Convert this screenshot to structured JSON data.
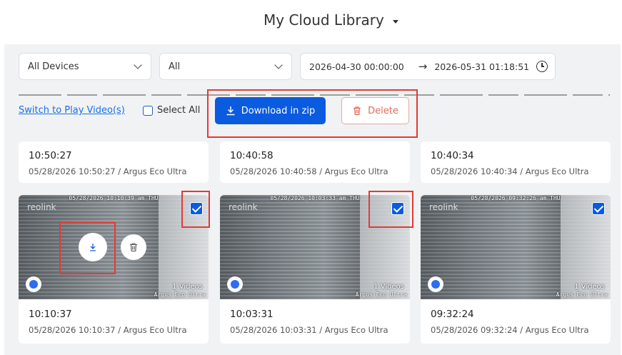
{
  "header": {
    "title": "My Cloud Library"
  },
  "filters": {
    "device": "All Devices",
    "type": "All",
    "date_start": "2026-04-30  00:00:00",
    "date_end": "2026-05-31  01:18:51",
    "arrow": "→"
  },
  "toolbar": {
    "switch_link": "Switch to Play Video(s)",
    "select_all": "Select All",
    "download_zip": "Download in zip",
    "delete": "Delete"
  },
  "top_row": [
    {
      "time": "10:50:27",
      "meta": "05/28/2026 10:50:27 / Argus Eco Ultra"
    },
    {
      "time": "10:40:58",
      "meta": "05/28/2026 10:40:58 / Argus Eco Ultra"
    },
    {
      "time": "10:40:34",
      "meta": "05/28/2026 10:40:34 / Argus Eco Ultra"
    }
  ],
  "videos": [
    {
      "osd": "05/28/2026 10:10:39 am THU",
      "count": "1 Videos",
      "camera": "Argus Eco Ultra",
      "time": "10:10:37",
      "meta": "05/28/2026 10:10:37 / Argus Eco Ultra",
      "logo": "reolink"
    },
    {
      "osd": "05/28/2026 10:03:33 am THU",
      "count": "1 Videos",
      "camera": "Argus Eco Ultra",
      "time": "10:03:31",
      "meta": "05/28/2026 10:03:31 / Argus Eco Ultra",
      "logo": "reolink"
    },
    {
      "osd": "05/28/2026 09:32:26 am THU",
      "count": "1 Videos",
      "camera": "Argus Eco Ultra",
      "time": "09:32:24",
      "meta": "05/28/2026 09:32:24 / Argus Eco Ultra",
      "logo": "reolink"
    }
  ],
  "colors": {
    "accent": "#0b5be1",
    "danger": "#e56a5c",
    "highlight": "#e53935",
    "link": "#1a6fe8"
  }
}
